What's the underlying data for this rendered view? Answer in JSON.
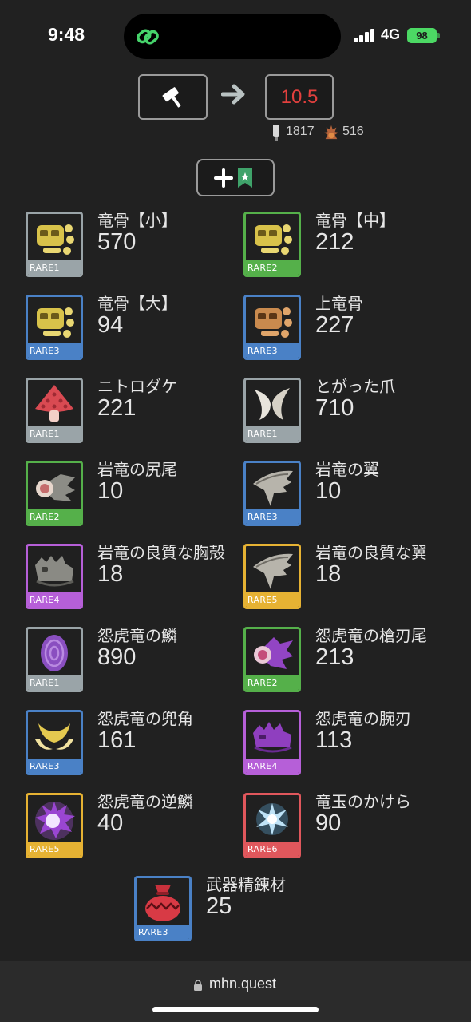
{
  "status": {
    "time": "9:48",
    "network": "4G",
    "battery": "98"
  },
  "top": {
    "result": "10.5",
    "sharpness_value": "1817",
    "zenny_value": "516"
  },
  "items": [
    {
      "name": "竜骨【小】",
      "count": "570",
      "rarity": "RARE1",
      "icon": "dragon-bone-icon"
    },
    {
      "name": "竜骨【中】",
      "count": "212",
      "rarity": "RARE2",
      "icon": "dragon-bone-icon"
    },
    {
      "name": "竜骨【大】",
      "count": "94",
      "rarity": "RARE3",
      "icon": "dragon-bone-icon"
    },
    {
      "name": "上竜骨",
      "count": "227",
      "rarity": "RARE3",
      "icon": "dragon-bone-icon"
    },
    {
      "name": "ニトロダケ",
      "count": "221",
      "rarity": "RARE1",
      "icon": "mushroom-icon"
    },
    {
      "name": "とがった爪",
      "count": "710",
      "rarity": "RARE1",
      "icon": "claw-icon"
    },
    {
      "name": "岩竜の尻尾",
      "count": "10",
      "rarity": "RARE2",
      "icon": "tail-icon"
    },
    {
      "name": "岩竜の翼",
      "count": "10",
      "rarity": "RARE3",
      "icon": "wing-icon"
    },
    {
      "name": "岩竜の良質な胸殻",
      "count": "18",
      "rarity": "RARE4",
      "icon": "carapace-icon"
    },
    {
      "name": "岩竜の良質な翼",
      "count": "18",
      "rarity": "RARE5",
      "icon": "wing-icon"
    },
    {
      "name": "怨虎竜の鱗",
      "count": "890",
      "rarity": "RARE1",
      "icon": "scale-icon"
    },
    {
      "name": "怨虎竜の槍刃尾",
      "count": "213",
      "rarity": "RARE2",
      "icon": "tail-icon"
    },
    {
      "name": "怨虎竜の兜角",
      "count": "161",
      "rarity": "RARE3",
      "icon": "horn-icon"
    },
    {
      "name": "怨虎竜の腕刃",
      "count": "113",
      "rarity": "RARE4",
      "icon": "carapace-icon"
    },
    {
      "name": "怨虎竜の逆鱗",
      "count": "40",
      "rarity": "RARE5",
      "icon": "gem-icon"
    },
    {
      "name": "竜玉のかけら",
      "count": "90",
      "rarity": "RARE6",
      "icon": "orb-icon"
    },
    {
      "name": "武器精錬材",
      "count": "25",
      "rarity": "RARE3",
      "icon": "bag-icon"
    }
  ],
  "browser": {
    "url": "mhn.quest"
  }
}
